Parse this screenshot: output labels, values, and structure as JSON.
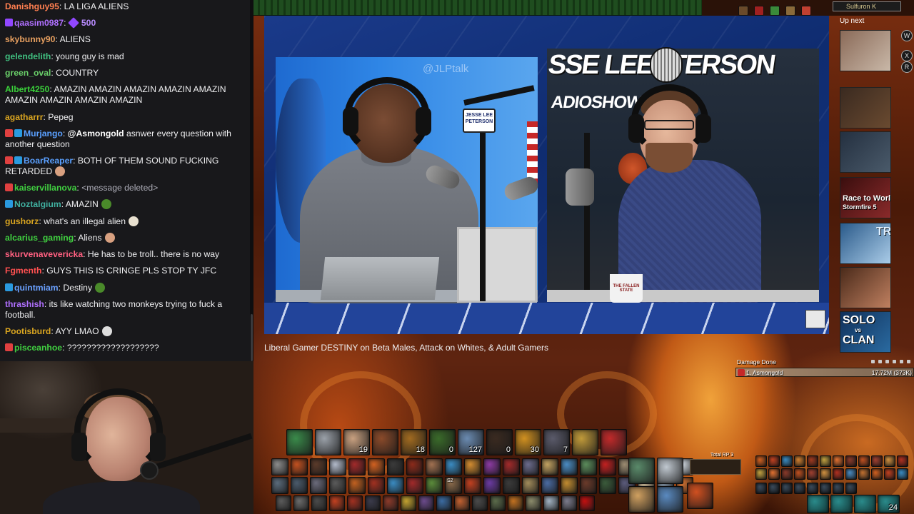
{
  "colors": {
    "chat_bg": "#18181b",
    "chat_text": "#efeff1",
    "accent": "#9147ff"
  },
  "chat": {
    "messages": [
      {
        "user": "Danishguy95",
        "color": "#ff7f50",
        "text": "LA LIGA ALIENS",
        "badges": [],
        "emote": ""
      },
      {
        "user": "qaasim0987",
        "color": "#b070ff",
        "text": "500",
        "badges": [
          "bits-badge"
        ],
        "emote": "bits-cheer-icon"
      },
      {
        "user": "skybunny90",
        "color": "#e8a060",
        "text": "ALIENS",
        "badges": [],
        "emote": ""
      },
      {
        "user": "gelendelith",
        "color": "#40c080",
        "text": "young guy is mad",
        "badges": [],
        "emote": ""
      },
      {
        "user": "green_oval",
        "color": "#6ad06a",
        "text": "COUNTRY",
        "badges": [],
        "emote": ""
      },
      {
        "user": "Albert4250",
        "color": "#3ad03a",
        "text": "AMAZIN AMAZIN AMAZIN AMAZIN AMAZIN AMAZIN AMAZIN AMAZIN AMAZIN",
        "badges": [],
        "emote": ""
      },
      {
        "user": "agatharrr",
        "color": "#daa520",
        "text": "Pepeg",
        "badges": [],
        "emote": ""
      },
      {
        "user": "Murjango",
        "color": "#5aa0ff",
        "mention": "@Asmongold",
        "text": "asnwer every question with another question",
        "badges": [
          "sub-badge",
          "prime-badge"
        ],
        "emote": ""
      },
      {
        "user": "BoarReaper",
        "color": "#5aa0ff",
        "text": "BOTH OF THEM SOUND FUCKING RETARDED",
        "badges": [
          "sub-badge",
          "prime-badge"
        ],
        "emote": "face-emote"
      },
      {
        "user": "kaiservillanova",
        "color": "#40d040",
        "text": "<message deleted>",
        "badges": [
          "sub-badge"
        ],
        "emote": ""
      },
      {
        "user": "Noztalgium",
        "color": "#40b0a0",
        "text": "AMAZIN",
        "badges": [
          "prime-badge"
        ],
        "emote": "pepe-emote"
      },
      {
        "user": "gushorz",
        "color": "#daa520",
        "text": "what's an illegal alien",
        "badges": [],
        "emote": "egg-emote"
      },
      {
        "user": "alcarius_gaming",
        "color": "#40d040",
        "text": "Aliens",
        "badges": [],
        "emote": "face-emote"
      },
      {
        "user": "skurvenaveverickа",
        "color": "#ff6080",
        "text": "He has to be troll.. there is no way",
        "badges": [],
        "emote": ""
      },
      {
        "user": "Fgmenth",
        "color": "#ff5050",
        "text": "GUYS THIS IS CRINGE PLS STOP TY JFC",
        "badges": [],
        "emote": ""
      },
      {
        "user": "quintmiam",
        "color": "#6aa0ff",
        "text": "Destiny",
        "badges": [
          "prime-badge"
        ],
        "emote": "pepe-emote"
      },
      {
        "user": "thrashish",
        "color": "#b070ff",
        "text": "its like watching two monkeys trying to fuck a football.",
        "badges": [],
        "emote": ""
      },
      {
        "user": "Pootisburd",
        "color": "#daa520",
        "text": "AYY LMAO",
        "badges": [],
        "emote": "skull-emote"
      },
      {
        "user": "pisceanhoe",
        "color": "#40d040",
        "text": "???????????????????",
        "badges": [
          "sub-badge"
        ],
        "emote": ""
      }
    ]
  },
  "video": {
    "title": "Liberal Gamer DESTINY on Beta Males, Attack on Whites, & Adult Gamers",
    "watermark": "@JLPtalk",
    "logo_line1": "SSE LEE",
    "logo_line1b": "ETERSON",
    "logo_line2": "ADIOSHOW",
    "mic_sign": "JESSE LEE PETERSON",
    "mug_text": "THE FALLEN STATE"
  },
  "sidebar": {
    "up_next_label": "Up next",
    "thumbs": [
      {
        "label": "",
        "color1": "#8a6a58",
        "color2": "#c9b8a8"
      },
      {
        "label": "",
        "color1": "#3a2a20",
        "color2": "#6a4a30"
      },
      {
        "label": "",
        "color1": "#243040",
        "color2": "#4a5a6a"
      },
      {
        "label": "Race to World",
        "sub": "Stormfire 5",
        "color1": "#3a0e0e",
        "color2": "#8a2a2a"
      },
      {
        "label": "TR",
        "color1": "#2a5a8a",
        "color2": "#aacce8"
      },
      {
        "label": "",
        "color1": "#4a2a1a",
        "color2": "#c08060"
      },
      {
        "label": "SOLO",
        "sub": "vs",
        "sub2": "CLAN",
        "color1": "#10305a",
        "color2": "#2a6aa0"
      }
    ],
    "buttons": [
      "W",
      "X",
      "R"
    ]
  },
  "server": {
    "name": "Sulfuron K"
  },
  "damage_meter": {
    "title": "Damage Done",
    "rank_name": "1. Asmongold",
    "value": "17.72M (373K)"
  },
  "action_bar": {
    "rp_label": "Total RP 3",
    "row1": [
      {
        "color": "#3a8a4a",
        "count": ""
      },
      {
        "color": "#9aa0a8",
        "count": ""
      },
      {
        "color": "#c8a080",
        "count": "19"
      },
      {
        "color": "#8a4a2a",
        "count": ""
      },
      {
        "color": "#a06a20",
        "count": "18"
      },
      {
        "color": "#3a6a2a",
        "count": "0"
      },
      {
        "color": "#6a8ab0",
        "count": "127"
      },
      {
        "color": "#3a2a20",
        "count": "0"
      },
      {
        "color": "#d09020",
        "count": "30"
      },
      {
        "color": "#5a5a6a",
        "count": "7"
      },
      {
        "color": "#c09a3a",
        "count": ""
      },
      {
        "color": "#c02a2a",
        "count": ""
      }
    ],
    "row2": [
      {
        "color": "#8a8a8a"
      },
      {
        "color": "#c05020"
      },
      {
        "color": "#5a3a2a"
      },
      {
        "color": "#b0b8c8"
      },
      {
        "color": "#a02a2a"
      },
      {
        "color": "#d06020"
      },
      {
        "color": "#3a3a3a"
      },
      {
        "color": "#8a2a1a"
      },
      {
        "color": "#a07050"
      },
      {
        "color": "#3a8ac0"
      },
      {
        "color": "#d08a30"
      },
      {
        "color": "#8a3aa0"
      },
      {
        "color": "#a02a2a"
      },
      {
        "color": "#6a6a8a"
      },
      {
        "color": "#c0a060"
      },
      {
        "color": "#4a8ac0"
      },
      {
        "color": "#5a8a5a"
      },
      {
        "color": "#c02020"
      },
      {
        "color": "#9a8a70"
      },
      {
        "color": "#c0c8d0"
      },
      {
        "color": "#8aa060"
      },
      {
        "color": "#d0d8e0"
      }
    ],
    "row3": [
      {
        "color": "#5a6a7a"
      },
      {
        "color": "#4a5a6a"
      },
      {
        "color": "#6a6a7a"
      },
      {
        "color": "#5a5a5a"
      },
      {
        "color": "#c06020"
      },
      {
        "color": "#a03020"
      },
      {
        "color": "#3a8ac0"
      },
      {
        "color": "#a02a2a"
      },
      {
        "color": "#5a8a3a"
      },
      {
        "color": "#8a6a4a"
      },
      {
        "color": "#c04020"
      },
      {
        "color": "#6a3aa0"
      },
      {
        "color": "#3a3a3a"
      },
      {
        "color": "#a08a5a"
      },
      {
        "color": "#4a6aa0"
      },
      {
        "color": "#c08a30"
      },
      {
        "color": "#6a3a2a"
      },
      {
        "color": "#3a5a3a"
      },
      {
        "color": "#5a5a7a"
      },
      {
        "color": "#c0b090"
      },
      {
        "color": "#7a8a9a"
      },
      {
        "color": "#d07030"
      }
    ],
    "row3_keys": [
      "",
      "",
      "",
      "",
      "",
      "",
      "",
      "",
      "",
      "S2",
      "",
      "",
      "",
      "",
      "",
      "",
      "",
      "",
      "",
      "",
      "",
      ""
    ],
    "row4": [
      {
        "color": "#5a5a5a"
      },
      {
        "color": "#6a6a6a"
      },
      {
        "color": "#4a4a4a"
      },
      {
        "color": "#c04020"
      },
      {
        "color": "#a03020"
      },
      {
        "color": "#3a3a4a"
      },
      {
        "color": "#8a3a2a"
      },
      {
        "color": "#c0a030"
      },
      {
        "color": "#6a4a8a"
      },
      {
        "color": "#3a6aa0"
      },
      {
        "color": "#c06030"
      },
      {
        "color": "#4a4a4a"
      },
      {
        "color": "#5a6a4a"
      },
      {
        "color": "#c07020"
      },
      {
        "color": "#8a8a6a"
      },
      {
        "color": "#a0b0c0"
      },
      {
        "color": "#7a7a8a"
      },
      {
        "color": "#c01010"
      }
    ],
    "row4_keys": [
      "",
      "",
      "",
      "",
      "",
      "",
      "",
      "",
      "",
      "",
      "",
      "",
      "",
      "",
      "",
      "",
      "",
      ""
    ],
    "right_bar_count": "24"
  }
}
